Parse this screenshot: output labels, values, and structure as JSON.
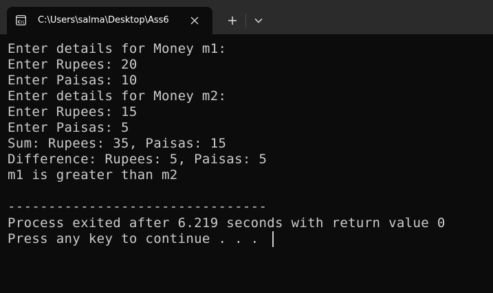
{
  "window": {
    "tab_title": "C:\\Users\\salma\\Desktop\\Ass6",
    "tab_icon": "terminal-icon",
    "close_icon": "close-icon",
    "new_tab_icon": "plus-icon",
    "dropdown_icon": "chevron-down-icon"
  },
  "terminal": {
    "lines": [
      "Enter details for Money m1:",
      "Enter Rupees: 20",
      "Enter Paisas: 10",
      "Enter details for Money m2:",
      "Enter Rupees: 15",
      "Enter Paisas: 5",
      "Sum: Rupees: 35, Paisas: 15",
      "Difference: Rupees: 5, Paisas: 5",
      "m1 is greater than m2",
      "",
      "--------------------------------",
      "Process exited after 6.219 seconds with return value 0",
      "Press any key to continue . . ."
    ]
  },
  "colors": {
    "titlebar": "#2b2b2b",
    "background": "#0c0c0c",
    "text": "#cccccc"
  }
}
